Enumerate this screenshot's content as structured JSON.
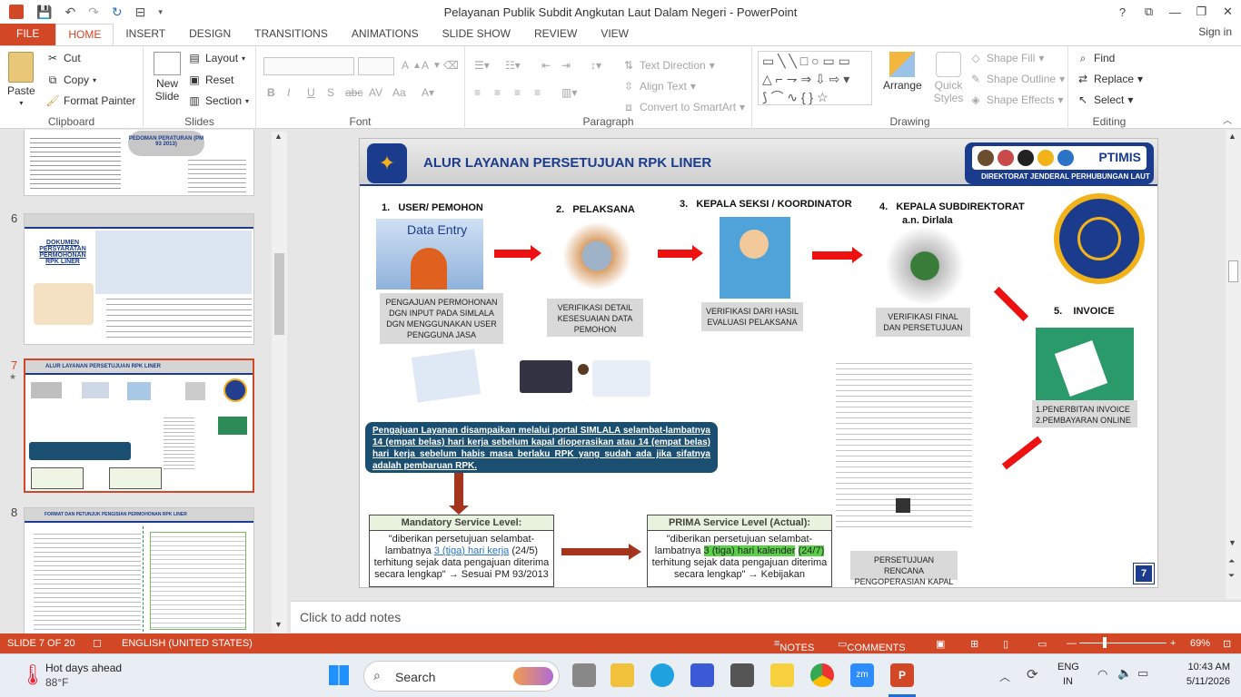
{
  "window": {
    "title": "Pelayanan Publik Subdit Angkutan Laut Dalam Negeri - PowerPoint"
  },
  "tabs": [
    "FILE",
    "HOME",
    "INSERT",
    "DESIGN",
    "TRANSITIONS",
    "ANIMATIONS",
    "SLIDE SHOW",
    "REVIEW",
    "VIEW"
  ],
  "signin": "Sign in",
  "ribbon": {
    "clipboard": {
      "paste": "Paste",
      "cut": "Cut",
      "copy": "Copy",
      "format_painter": "Format Painter",
      "label": "Clipboard"
    },
    "slides": {
      "new_slide": "New Slide",
      "layout": "Layout",
      "reset": "Reset",
      "section": "Section",
      "label": "Slides"
    },
    "font": {
      "label": "Font",
      "bold": "B",
      "italic": "I",
      "underline": "U",
      "strike": "S",
      "abc": "abc"
    },
    "paragraph": {
      "label": "Paragraph",
      "text_direction": "Text Direction",
      "align_text": "Align Text",
      "convert": "Convert to SmartArt"
    },
    "drawing": {
      "arrange": "Arrange",
      "quick_styles": "Quick Styles",
      "shape_fill": "Shape Fill",
      "shape_outline": "Shape Outline",
      "shape_effects": "Shape Effects",
      "label": "Drawing"
    },
    "editing": {
      "find": "Find",
      "replace": "Replace",
      "select": "Select",
      "label": "Editing"
    }
  },
  "thumbnails": [
    {
      "num": "6",
      "title": "DOKUMEN PERSYARATAN PERMOHONAN RPK LINER"
    },
    {
      "num": "7",
      "title": "ALUR LAYANAN PERSETUJUAN RPK LINER"
    },
    {
      "num": "8",
      "title": "FORMAT DAN PETUNJUK PENGISIAN PERMOHONAN RPK LINER"
    }
  ],
  "thumb_prev": {
    "badge": "PEDOMAN PERATURAN (PM 93 2013)"
  },
  "slide": {
    "title": "ALUR LAYANAN PERSETUJUAN RPK LINER",
    "logo_text": "PTIMIS",
    "directorate": "DIREKTORAT JENDERAL PERHUBUNGAN LAUT",
    "steps": [
      {
        "num": "1.",
        "title": "USER/ PEMOHON",
        "img_label": "Data Entry",
        "desc": "PENGAJUAN PERMOHONAN DGN INPUT PADA SIMLALA DGN MENGGUNAKAN USER PENGGUNA JASA"
      },
      {
        "num": "2.",
        "title": "PELAKSANA",
        "desc": "VERIFIKASI DETAIL KESESUAIAN DATA PEMOHON"
      },
      {
        "num": "3.",
        "title": "KEPALA SEKSI / KOORDINATOR",
        "desc": "VERIFIKASI DARI HASIL EVALUASI PELAKSANA"
      },
      {
        "num": "4.",
        "title": "KEPALA SUBDIREKTORAT",
        "subtitle": "a.n. Dirlala",
        "desc": "VERIFIKASI FINAL DAN PERSETUJUAN"
      },
      {
        "num": "5.",
        "title": "INVOICE",
        "desc1": "1.PENERBITAN INVOICE",
        "desc2": "2.PEMBAYARAN ONLINE"
      }
    ],
    "info_text": "Pengajuan Layanan disampaikan melalui portal SIMLALA selambat-lambatnya 14 (empat belas) hari kerja sebelum kapal dioperasikan atau 14 (empat belas) hari kerja sebelum habis masa berlaku RPK yang sudah ada jika sifatnya adalah pembaruan RPK.",
    "mandatory": {
      "title": "Mandatory Service Level:",
      "pre": "\"diberikan persetujuan selambat-lambatnya ",
      "hl": "3 (tiga) hari kerja",
      "post": " (24/5) terhitung sejak data pengajuan diterima secara lengkap\" → Sesuai PM 93/2013"
    },
    "prima": {
      "title": "PRIMA Service Level (Actual):",
      "pre": "\"diberikan persetujuan selambat-lambatnya ",
      "hl": "3 (tiga) hari kalender",
      "hl2": "(24/7)",
      "post": " terhitung sejak data pengajuan diterima secara lengkap\" → Kebijakan"
    },
    "approval_label": "PERSETUJUAN RENCANA PENGOPERASIAN KAPAL",
    "page_num": "7"
  },
  "notes_placeholder": "Click to add notes",
  "status": {
    "slide": "SLIDE 7 OF 20",
    "lang": "ENGLISH (UNITED STATES)",
    "notes": "NOTES",
    "comments": "COMMENTS",
    "zoom": "69%"
  },
  "taskbar": {
    "weather_title": "Hot days ahead",
    "weather_temp": "88°F",
    "search": "Search",
    "lang1": "ENG",
    "lang2": "IN",
    "time": "10:43 AM",
    "date": "5/11/2026"
  }
}
